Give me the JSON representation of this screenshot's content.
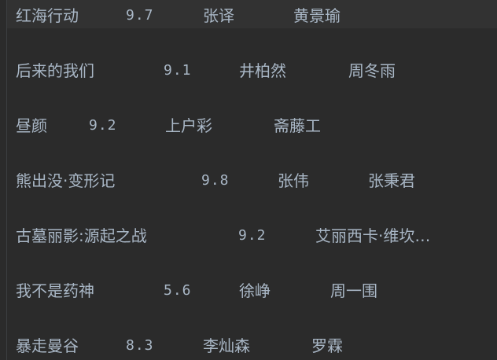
{
  "movies": [
    {
      "title": "红海行动",
      "score": "9.7",
      "director": "张译",
      "actor": "黄景瑜"
    },
    {
      "title": "后来的我们",
      "score": "9.1",
      "director": "井柏然",
      "actor": "周冬雨"
    },
    {
      "title": "昼颜",
      "score": "9.2",
      "director": "上户彩",
      "actor": "斋藤工"
    },
    {
      "title": "熊出没·变形记",
      "score": "9.8",
      "director": "张伟",
      "actor": "张秉君"
    },
    {
      "title": "古墓丽影:源起之战",
      "score": "9.2",
      "director": "艾丽西卡·维坎…",
      "actor": ""
    },
    {
      "title": "我不是药神",
      "score": "5.6",
      "director": "徐峥",
      "actor": "周一围"
    },
    {
      "title": "暴走曼谷",
      "score": "8.3",
      "director": "李灿森",
      "actor": "罗霖"
    }
  ]
}
